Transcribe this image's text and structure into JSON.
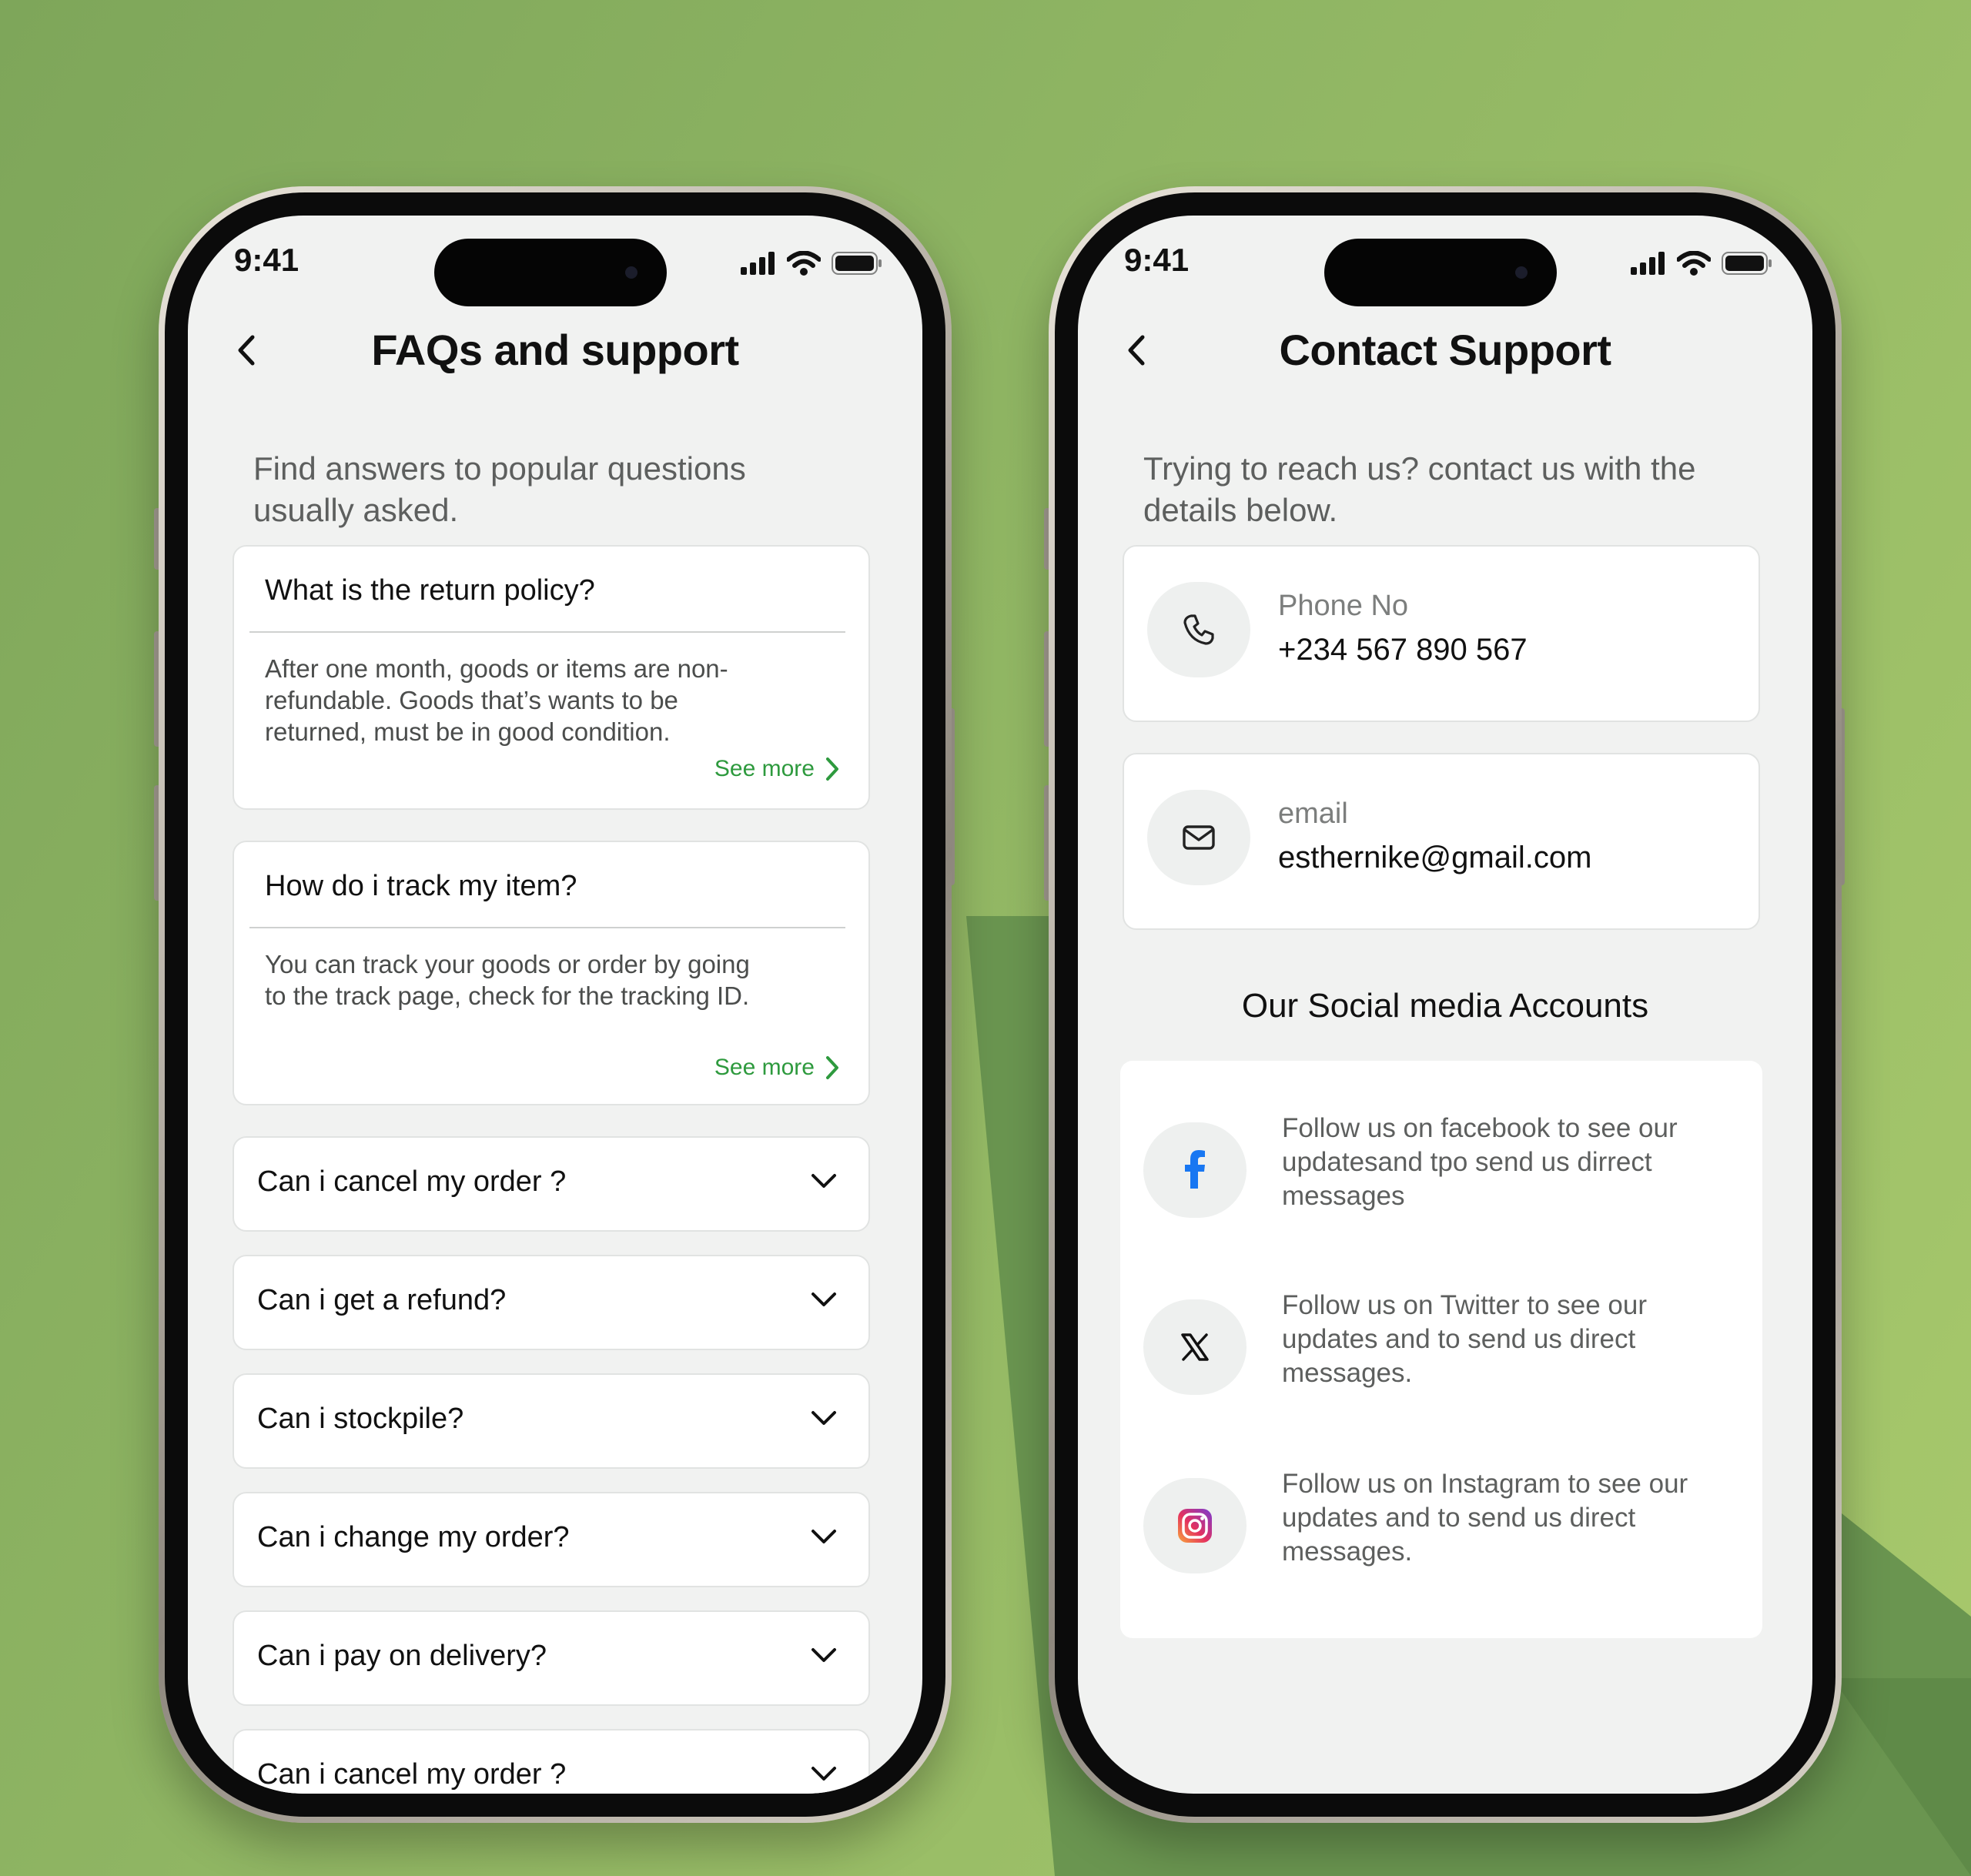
{
  "status_bar": {
    "time": "9:41"
  },
  "faq_screen": {
    "title": "FAQs and support",
    "intro": "Find answers to popular questions usually asked.",
    "expanded": [
      {
        "question": "What is the return policy?",
        "answer": "After one month, goods or items are non-refundable. Goods that’s wants to be returned, must be in good condition.",
        "see_more": "See more"
      },
      {
        "question": "How do i track my item?",
        "answer": "You can track your goods or order by going to the track page, check for the tracking ID.",
        "see_more": "See more"
      }
    ],
    "collapsed": [
      "Can i cancel my order ?",
      "Can i get a refund?",
      "Can i stockpile?",
      "Can i change my order?",
      "Can i pay on delivery?",
      "Can i cancel my order ?"
    ]
  },
  "contact_screen": {
    "title": "Contact Support",
    "intro": "Trying to reach us? contact us with the details below.",
    "phone": {
      "label": "Phone No",
      "value": "+234 567 890 567",
      "icon": "phone-icon"
    },
    "email": {
      "label": "email",
      "value": "esthernike@gmail.com",
      "icon": "mail-icon"
    },
    "social_heading": "Our Social media Accounts",
    "social": [
      {
        "icon": "facebook-icon",
        "text": "Follow us on facebook to see our updatesand tpo send us dirrect messages"
      },
      {
        "icon": "x-twitter-icon",
        "text": "Follow us on Twitter to see our updates and to send us direct messages."
      },
      {
        "icon": "instagram-icon",
        "text": "Follow us on Instagram to see our updates and to send us direct messages."
      }
    ]
  },
  "colors": {
    "accent_green": "#2e9a3e",
    "background_green": "#8fb563",
    "facebook_blue": "#1877f2",
    "screen_bg": "#f1f2f1"
  }
}
